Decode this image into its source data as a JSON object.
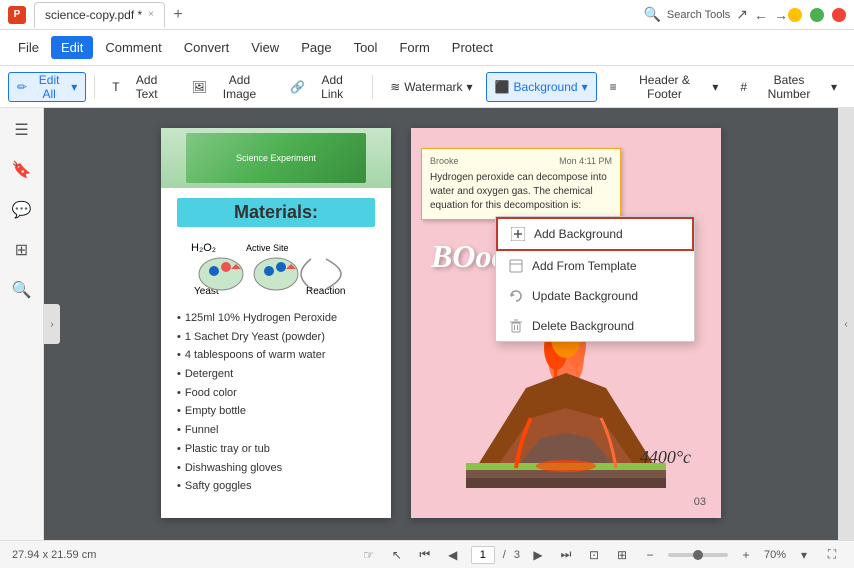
{
  "titlebar": {
    "app_icon": "P",
    "tab_label": "science-copy.pdf *",
    "close_tab": "×",
    "add_tab": "+",
    "search_placeholder": "Search Tools",
    "icons": [
      "profile",
      "extension",
      "more",
      "minimize",
      "maximize",
      "close"
    ]
  },
  "menubar": {
    "items": [
      "File",
      "Edit",
      "Comment",
      "Convert",
      "View",
      "Page",
      "Tool",
      "Form",
      "Protect"
    ]
  },
  "toolbar": {
    "edit_all": "Edit All",
    "edit_arrow": "▾",
    "add_text": "Add Text",
    "add_image": "Add Image",
    "add_link": "Add Link",
    "watermark": "Watermark",
    "watermark_arrow": "▾",
    "background": "Background",
    "background_arrow": "▾",
    "header_footer": "Header & Footer",
    "header_arrow": "▾",
    "bates_number": "Bates Number",
    "bates_arrow": "▾"
  },
  "dropdown": {
    "items": [
      {
        "id": "add-background",
        "icon": "+",
        "label": "Add Background",
        "highlighted": true
      },
      {
        "id": "add-from-template",
        "icon": "doc",
        "label": "Add From Template",
        "highlighted": false
      },
      {
        "id": "update-background",
        "icon": "refresh",
        "label": "Update Background",
        "highlighted": false
      },
      {
        "id": "delete-background",
        "icon": "trash",
        "label": "Delete Background",
        "highlighted": false
      }
    ]
  },
  "left_page": {
    "title": "Materials:",
    "list_items": [
      "125ml 10% Hydrogen Peroxide",
      "1 Sachet Dry Yeast (powder)",
      "4 tablespoons of warm water",
      "Detergent",
      "Food color",
      "Empty bottle",
      "Funnel",
      "Plastic tray or tub",
      "Dishwashing gloves",
      "Safty goggles"
    ]
  },
  "right_page": {
    "sticky": {
      "author": "Brooke",
      "time": "Mon 4:11 PM",
      "text": "Hydrogen peroxide can decompose into water and oxygen gas. The chemical equation for this decomposition is:"
    },
    "boom_text": "BOoooom!",
    "temp_label": "4400°c",
    "page_number": "03"
  },
  "statusbar": {
    "dimensions": "27.94 x 21.59 cm",
    "page_current": "1",
    "page_total": "3",
    "zoom_value": "70%"
  }
}
